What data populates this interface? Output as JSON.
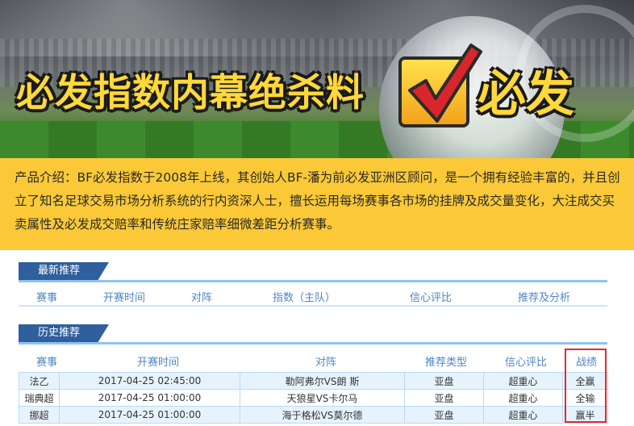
{
  "banner": {
    "title": "必发指数内幕绝杀料",
    "badge_text": "必发"
  },
  "intro": {
    "text": "产品介绍：BF必发指数于2008年上线，其创始人BF-潘为前必发亚洲区顾问，是一个拥有经验丰富的，并且创立了知名足球交易市场分析系统的行内资深人士，擅长运用每场赛事各市场的挂牌及成交量变化，大注成交买卖属性及必发成交赔率和传统庄家赔率细微差距分析赛事。"
  },
  "latest": {
    "label": "最新推荐",
    "headers": [
      "赛事",
      "开赛时间",
      "对阵",
      "指数（主队）",
      "信心评比",
      "推荐及分析"
    ]
  },
  "history": {
    "label": "历史推荐",
    "headers": [
      "赛事",
      "开赛时间",
      "对阵",
      "推荐类型",
      "信心评比",
      "战绩"
    ],
    "rows": [
      [
        "法乙",
        "2017-04-25 02:45:00",
        "勒阿弗尔VS朗 斯",
        "亚盘",
        "超重心",
        "全赢"
      ],
      [
        "瑞典超",
        "2017-04-25 01:00:00",
        "天狼星VS卡尔马",
        "亚盘",
        "超重心",
        "全输"
      ],
      [
        "挪超",
        "2017-04-25 01:00:00",
        "海于格松VS莫尔德",
        "亚盘",
        "超重心",
        "赢半"
      ]
    ]
  },
  "colors": {
    "intro_bg": "#fbc937",
    "tab_bg": "#2f5f9c",
    "header_text": "#4f86c6",
    "row_bg": "#e7f3fc",
    "highlight_border": "#e22b2b"
  }
}
